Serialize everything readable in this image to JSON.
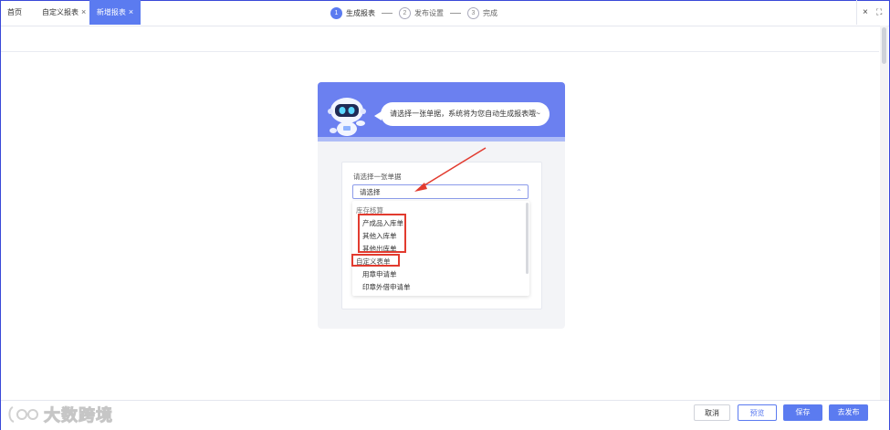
{
  "tabs": {
    "home_label": "首页",
    "custom_report_label": "自定义报表",
    "new_report_label": "新增报表",
    "close_glyph": "×",
    "window_close_glyph": "×",
    "window_fullscreen_glyph": "⛶"
  },
  "steps": [
    {
      "number": "1",
      "label": "生成报表",
      "active": true
    },
    {
      "number": "2",
      "label": "发布设置",
      "active": false
    },
    {
      "number": "3",
      "label": "完成",
      "active": false
    }
  ],
  "banner": {
    "message": "请选择一张单据，系统将为您自动生成报表哦~"
  },
  "form": {
    "label": "请选择一张单据",
    "select_value": "请选择",
    "chevron": "⌃"
  },
  "dropdown": {
    "groups": [
      {
        "name": "库存核算",
        "items": [
          "产成品入库单",
          "其他入库单",
          "其他出库单"
        ]
      },
      {
        "name": "自定义表单",
        "items": [
          "用章申请单",
          "印章外借申请单"
        ]
      }
    ]
  },
  "footer": {
    "cancel_label": "取消",
    "preview_label": "预览",
    "save_label": "保存",
    "publish_label": "去发布"
  },
  "watermark": {
    "text": "大数跨境"
  },
  "colors": {
    "accent": "#5b7bf0",
    "highlight": "#e23b2f",
    "banner": "#6b80f0"
  }
}
